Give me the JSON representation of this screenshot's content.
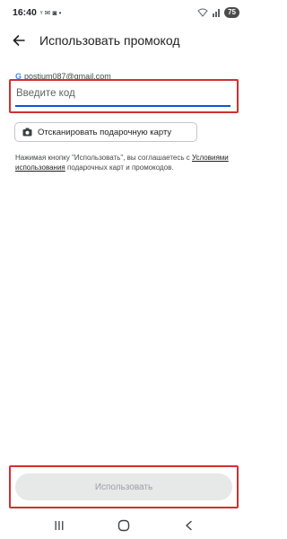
{
  "status_bar": {
    "time": "16:40",
    "left_glyphs": "ᵞ ✉ ◙ •",
    "battery": "75"
  },
  "app_bar": {
    "title": "Использовать промокод"
  },
  "account": {
    "google_letter": "G",
    "email": "postium087@gmail.com"
  },
  "code_input": {
    "placeholder": "Введите код",
    "value": ""
  },
  "scan_button": {
    "label": "Отсканировать подарочную карту"
  },
  "terms": {
    "prefix": "Нажимая кнопку \"Использовать\", вы соглашаетесь с ",
    "link": "Условиями использования",
    "suffix": " подарочных карт и промокодов."
  },
  "submit_button": {
    "label": "Использовать"
  },
  "icons": {
    "back": "arrow-left",
    "camera": "camera",
    "nav_recents": "recents",
    "nav_home": "home",
    "nav_back": "chevron-left"
  },
  "colors": {
    "accent": "#0b57d0",
    "highlight": "#d32f2f",
    "disabled_button": "#e7e8e8"
  }
}
